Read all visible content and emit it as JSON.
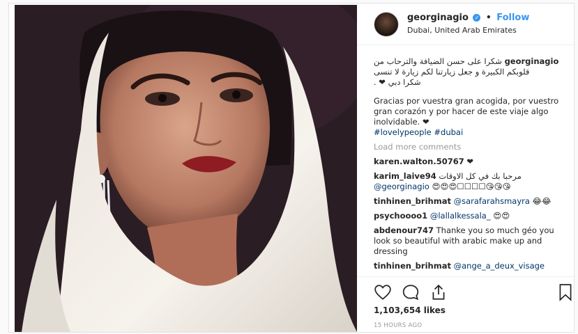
{
  "post": {
    "username": "georginagio",
    "verified_glyph": "✓",
    "separator": "•",
    "follow_label": "Follow",
    "location": "Dubai, United Arab Emirates"
  },
  "caption": {
    "arabic_line1_user": "georginagio",
    "arabic_line1_text": " شكرا على حسن الضيافة والترحاب من",
    "arabic_line2": "قلوبكم الكبيرة و جعل زيارتنا لكم زيارة لا تنسى",
    "arabic_line3": "شكرا دبي ❤ .",
    "spanish_text": "Gracias por vuestra gran acogida, por vuestro gran corazón y por hacer de este viaje algo inolvidable. ❤",
    "hashtags": "#lovelypeople #dubai"
  },
  "load_more_label": "Load more comments",
  "comments": [
    {
      "user": "karen.walton.50767",
      "text": " ❤"
    },
    {
      "user": "karim_laive94",
      "text": " مرحبا بك في كل الاوقات",
      "mention": "@georginagio",
      "extra": " 😍😍😍☐☐☐☐😘😘😘"
    },
    {
      "user": "tinhinen_brihmat",
      "mention": "@sarafarahsmayra",
      "text": " 😂😂"
    },
    {
      "user": "psychoooo1",
      "mention": "@lallalkessala_",
      "text": " 😍😍"
    },
    {
      "user": "abdenour747",
      "text": " Thanke you so much géo you look so beautiful with arabic make up and dressing"
    },
    {
      "user": "tinhinen_brihmat",
      "mention": "@ange_a_deux_visage",
      "text": ""
    }
  ],
  "icons": {
    "like": "heart-icon",
    "comment": "comment-icon",
    "share": "share-icon",
    "save": "bookmark-icon"
  },
  "likes": "1,103,654 likes",
  "timestamp": "15 HOURS AGO"
}
